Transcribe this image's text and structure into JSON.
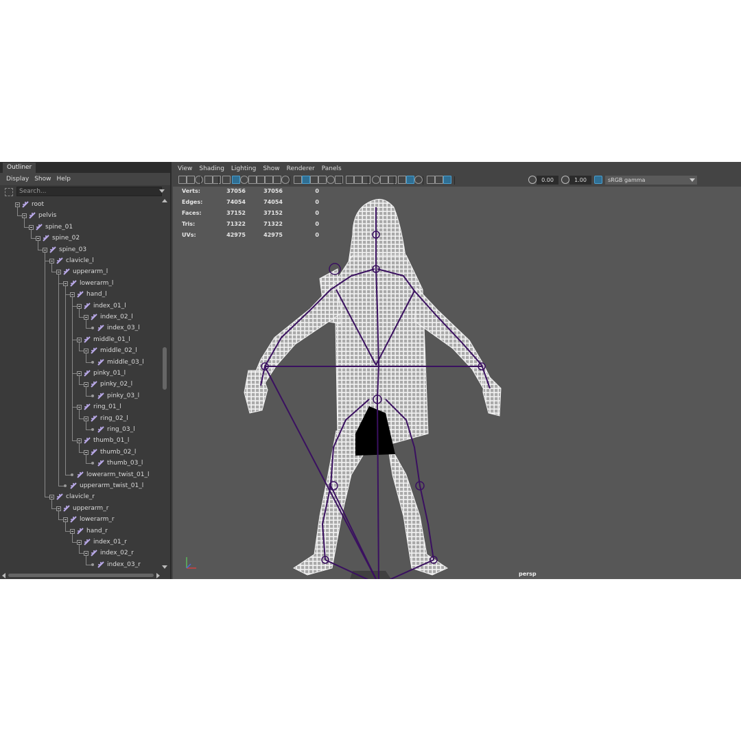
{
  "outliner": {
    "tab_label": "Outliner",
    "menus": [
      "Display",
      "Show",
      "Help"
    ],
    "search_placeholder": "Search...",
    "nodes": [
      {
        "label": "root",
        "depth": 0
      },
      {
        "label": "pelvis",
        "depth": 1
      },
      {
        "label": "spine_01",
        "depth": 2
      },
      {
        "label": "spine_02",
        "depth": 3
      },
      {
        "label": "spine_03",
        "depth": 4
      },
      {
        "label": "clavicle_l",
        "depth": 5
      },
      {
        "label": "upperarm_l",
        "depth": 6
      },
      {
        "label": "lowerarm_l",
        "depth": 7
      },
      {
        "label": "hand_l",
        "depth": 8
      },
      {
        "label": "index_01_l",
        "depth": 9
      },
      {
        "label": "index_02_l",
        "depth": 10
      },
      {
        "label": "index_03_l",
        "depth": 11
      },
      {
        "label": "middle_01_l",
        "depth": 9
      },
      {
        "label": "middle_02_l",
        "depth": 10
      },
      {
        "label": "middle_03_l",
        "depth": 11
      },
      {
        "label": "pinky_01_l",
        "depth": 9
      },
      {
        "label": "pinky_02_l",
        "depth": 10
      },
      {
        "label": "pinky_03_l",
        "depth": 11
      },
      {
        "label": "ring_01_l",
        "depth": 9
      },
      {
        "label": "ring_02_l",
        "depth": 10
      },
      {
        "label": "ring_03_l",
        "depth": 11
      },
      {
        "label": "thumb_01_l",
        "depth": 9
      },
      {
        "label": "thumb_02_l",
        "depth": 10
      },
      {
        "label": "thumb_03_l",
        "depth": 11
      },
      {
        "label": "lowerarm_twist_01_l",
        "depth": 8
      },
      {
        "label": "upperarm_twist_01_l",
        "depth": 7
      },
      {
        "label": "clavicle_r",
        "depth": 5
      },
      {
        "label": "upperarm_r",
        "depth": 6
      },
      {
        "label": "lowerarm_r",
        "depth": 7
      },
      {
        "label": "hand_r",
        "depth": 8
      },
      {
        "label": "index_01_r",
        "depth": 9
      },
      {
        "label": "index_02_r",
        "depth": 10
      },
      {
        "label": "index_03_r",
        "depth": 11
      }
    ]
  },
  "viewport": {
    "menus": [
      "View",
      "Shading",
      "Lighting",
      "Show",
      "Renderer",
      "Panels"
    ],
    "exposure_value": "0.00",
    "gamma_value": "1.00",
    "color_space": "sRGB gamma",
    "camera_label": "persp",
    "stats": [
      {
        "label": "Verts:",
        "v1": "37056",
        "v2": "37056",
        "v3": "0"
      },
      {
        "label": "Edges:",
        "v1": "74054",
        "v2": "74054",
        "v3": "0"
      },
      {
        "label": "Faces:",
        "v1": "37152",
        "v2": "37152",
        "v3": "0"
      },
      {
        "label": "Tris:",
        "v1": "71322",
        "v2": "71322",
        "v3": "0"
      },
      {
        "label": "UVs:",
        "v1": "42975",
        "v2": "42975",
        "v3": "0"
      }
    ],
    "toolbar_icons": [
      "camera-select-icon",
      "camera-attributes-icon",
      "bookmark-icon",
      "image-plane-icon",
      "2d-pan-icon",
      "grease-pencil-icon",
      "grid-icon",
      "film-gate-icon",
      "resolution-gate-icon",
      "gate-mask-icon",
      "field-chart-icon",
      "safe-action-icon",
      "safe-title-icon",
      "wireframe-icon",
      "smooth-shade-icon",
      "default-material-icon",
      "wireframe-on-shaded-icon",
      "xray-icon",
      "xray-joints-icon",
      "use-lights-icon",
      "shadows-icon",
      "ambient-occlusion-icon",
      "motion-blur-icon",
      "anti-aliasing-icon",
      "depth-of-field-icon",
      "isolate-select-icon",
      "xray-active-icon",
      "xray-component-icon",
      "exposure-icon",
      "gamma-icon",
      "color-management-icon"
    ]
  },
  "colors": {
    "joint_purple": "#3a1060",
    "joint_icon": "#b9a9e8",
    "wire_white": "#f2f2f2",
    "viewport_bg": "#575757"
  }
}
